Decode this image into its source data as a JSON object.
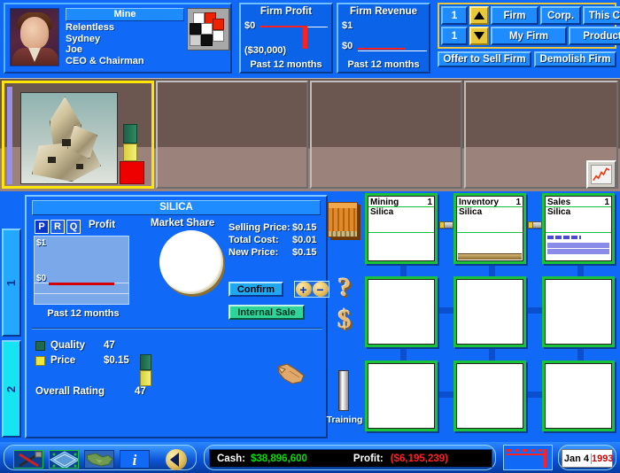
{
  "header": {
    "ceo": {
      "title": "Mine",
      "lines": [
        "Relentless",
        "Sydney",
        "Joe",
        "CEO & Chairman"
      ],
      "portrait_icon": "ceo-portrait",
      "logo_icon": "company-cube-logo"
    },
    "firm_profit": {
      "title": "Firm Profit",
      "top_label": "$0",
      "bottom_label": "($30,000)",
      "footer": "Past 12 months"
    },
    "firm_revenue": {
      "title": "Firm Revenue",
      "top_label": "$1",
      "bottom_label": "$0",
      "footer": "Past 12 months"
    },
    "controls": {
      "row1_number": "1",
      "row2_number": "1",
      "up_arrow_icon": "triangle-up-icon",
      "down_arrow_icon": "triangle-down-icon",
      "firm": "Firm",
      "corp": "Corp.",
      "this_city": "This City",
      "my_firm": "My Firm",
      "product": "Product",
      "offer_to_sell": "Offer to Sell Firm",
      "demolish": "Demolish Firm"
    }
  },
  "strip": {
    "chart_icon": "line-chart-icon",
    "selected_lot_icon": "silica-mineral-image"
  },
  "tabs": {
    "tab1": "1",
    "tab2": "2"
  },
  "product": {
    "title": "SILICA",
    "prq": [
      "P",
      "R",
      "Q"
    ],
    "profit_label": "Profit",
    "market_share_label": "Market Share",
    "graph": {
      "top": "$1",
      "bottom": "$0",
      "footer": "Past 12 months"
    },
    "prices": [
      {
        "key": "Selling Price:",
        "value": "$0.15"
      },
      {
        "key": "Total Cost:",
        "value": "$0.01"
      },
      {
        "key": "New Price:",
        "value": "$0.15"
      }
    ],
    "confirm": "Confirm",
    "plus": "+",
    "minus": "−",
    "internal_sale": "Internal Sale",
    "ratings": [
      {
        "swatch": "green",
        "key": "Quality",
        "value": "47"
      },
      {
        "swatch": "yellow",
        "key": "Price",
        "value": "$0.15"
      }
    ],
    "overall_label": "Overall Rating",
    "overall_value": "47",
    "hand_icon": "pointing-hand-cursor-icon"
  },
  "icon_column": {
    "crate_icon": "crate-icon",
    "question_icon": "question-mark-icon",
    "dollar_icon": "dollar-sign-icon",
    "training_bar_icon": "training-bar-icon",
    "training_label": "Training"
  },
  "departments": [
    {
      "name": "Mining",
      "count": "1",
      "product": "Silica"
    },
    {
      "name": "Inventory",
      "count": "1",
      "product": "Silica"
    },
    {
      "name": "Sales",
      "count": "1",
      "product": "Silica"
    }
  ],
  "statusbar": {
    "tools_icon": "hammer-wrench-icon",
    "city-grid_icon": "city-map-icon",
    "world_icon": "world-map-icon",
    "info_icon": "info-i-icon",
    "back_icon": "back-arrow-icon",
    "cash_label": "Cash:",
    "cash_value": "$38,896,600",
    "profit_label": "Profit:",
    "profit_value": "($6,195,239)",
    "mini_chart_icon": "mini-chart-icon",
    "date_month": "Jan 4",
    "date_year": "1993"
  },
  "colors": {
    "background_blue": "#1169f7",
    "panel_blue": "#0b63e8",
    "accent_yellow": "#e8c83a",
    "cash_green": "#00e000",
    "loss_red": "#ff2020",
    "dept_green": "#19c23a"
  }
}
